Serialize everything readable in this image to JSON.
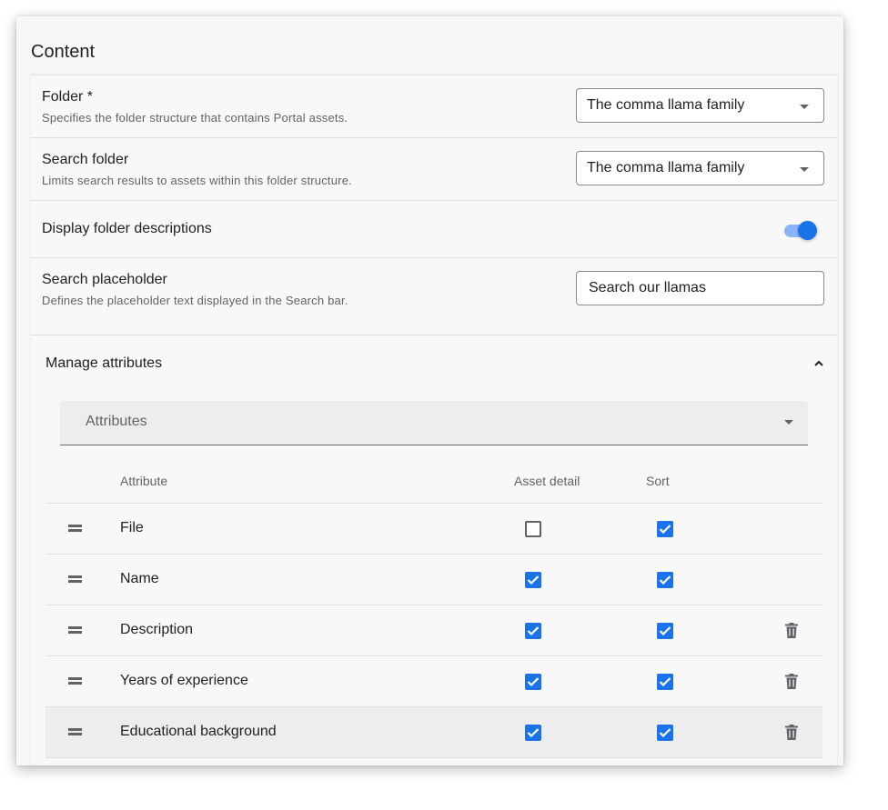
{
  "section": {
    "title": "Content"
  },
  "settings": {
    "folder": {
      "title": "Folder *",
      "description": "Specifies the folder structure that contains Portal assets.",
      "value": "The comma llama family"
    },
    "search_folder": {
      "title": "Search folder",
      "description": "Limits search results to assets within this folder structure.",
      "value": "The comma llama family"
    },
    "display_descriptions": {
      "title": "Display folder descriptions",
      "enabled": true
    },
    "search_placeholder": {
      "title": "Search placeholder",
      "description": "Defines the placeholder text displayed in the Search bar.",
      "value": "Search our llamas"
    }
  },
  "manage_attributes": {
    "title": "Manage attributes",
    "dropdown_label": "Attributes",
    "columns": {
      "attribute": "Attribute",
      "asset_detail": "Asset detail",
      "sort": "Sort"
    },
    "rows": [
      {
        "name": "File",
        "asset_detail": false,
        "sort": true,
        "deletable": false
      },
      {
        "name": "Name",
        "asset_detail": true,
        "sort": true,
        "deletable": false
      },
      {
        "name": "Description",
        "asset_detail": true,
        "sort": true,
        "deletable": true
      },
      {
        "name": "Years of experience",
        "asset_detail": true,
        "sort": true,
        "deletable": true
      },
      {
        "name": "Educational background",
        "asset_detail": true,
        "sort": true,
        "deletable": true
      }
    ]
  },
  "colors": {
    "accent": "#1a73e8",
    "toggle_track": "#8ab4f8",
    "panel_bg": "#f7f7f7"
  },
  "icons": {
    "drag": "drag-handle-icon",
    "delete": "trash-icon",
    "collapse": "chevron-up-icon",
    "dropdown": "caret-down-icon"
  }
}
